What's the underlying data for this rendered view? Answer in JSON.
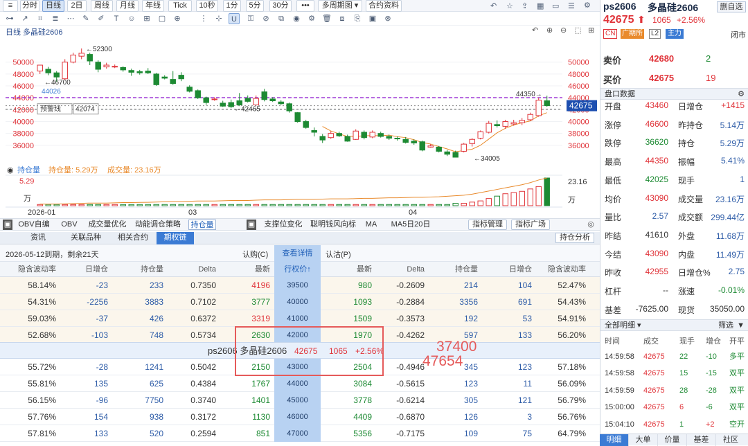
{
  "colors": {
    "up": "#e0343a",
    "down": "#1d8a33",
    "accent": "#3b7bd4",
    "ma": "#e98a2b",
    "warn": "#a03ad6"
  },
  "topbar": {
    "periods": [
      "分时",
      "日线",
      "2日",
      "周线",
      "月线",
      "年线",
      "Tick",
      "10秒",
      "1分",
      "5分",
      "30分"
    ],
    "more": "•••",
    "multi": "多周期图 ▾",
    "contract_info": "合约资料"
  },
  "toolbar": {
    "icons": [
      "trend-line-icon",
      "ray-icon",
      "horizontal-line-icon",
      "channel-icon",
      "fibonacci-icon",
      "text-icon",
      "measure-icon",
      "rect-icon",
      "magnet-icon",
      "eye-icon",
      "settings-icon",
      "lock-icon",
      "delete-icon",
      "layers-icon"
    ],
    "right_icons": [
      "undo-icon",
      "zoom-in-icon",
      "zoom-out-icon",
      "fit-icon",
      "restore-icon"
    ]
  },
  "chart": {
    "title": "日线  多晶硅2606",
    "annotations": {
      "high": "52300",
      "low_left": "46700",
      "low_mid": "42465",
      "recent_high": "44350",
      "low_right": "34005",
      "ref_price": "44026",
      "alert_label": "预警线",
      "alert_value": "42074",
      "current_price": "42675"
    },
    "y_ticks": [
      "50000",
      "48000",
      "46000",
      "44000",
      "42000",
      "40000",
      "38000",
      "36000"
    ],
    "oi_legend": "持仓量",
    "oi_label": "持仓量: 5.29万",
    "vol_label": "成交量: 23.16万",
    "oi_axis_top": "5.29",
    "oi_axis_unit": "万",
    "vol_axis_top": "23.16",
    "vol_axis_unit": "万",
    "x_labels": [
      "2026-01",
      "03",
      "04"
    ]
  },
  "chart_data": {
    "type": "candlestick",
    "y_range": [
      34000,
      53000
    ],
    "candles": [
      [
        48500,
        49500,
        49000,
        48000
      ],
      [
        48800,
        48200,
        49200,
        47800
      ],
      [
        48200,
        47500,
        48500,
        46700
      ],
      [
        47200,
        50000,
        50500,
        47000
      ],
      [
        50000,
        51200,
        51600,
        49800
      ],
      [
        51000,
        51500,
        52300,
        50500
      ],
      [
        51300,
        50200,
        51600,
        49500
      ],
      [
        50000,
        48800,
        50300,
        48300
      ],
      [
        49200,
        49500,
        49900,
        48900
      ],
      [
        49300,
        49300,
        49600,
        49000
      ],
      [
        49100,
        48700,
        49300,
        48400
      ],
      [
        48600,
        48300,
        48900,
        47700
      ],
      [
        48400,
        48200,
        48700,
        47900
      ],
      [
        48500,
        48200,
        49000,
        48000
      ],
      [
        48000,
        46200,
        48200,
        46000
      ],
      [
        47500,
        47300,
        47800,
        47100
      ],
      [
        47100,
        46400,
        48500,
        46200
      ],
      [
        47800,
        47200,
        48300,
        46800
      ],
      [
        45800,
        45100,
        46100,
        44900
      ],
      [
        45200,
        44000,
        45400,
        43800
      ],
      [
        44000,
        43200,
        44200,
        42800
      ],
      [
        43700,
        43800,
        44100,
        43500
      ],
      [
        43100,
        42600,
        43500,
        42465
      ],
      [
        43200,
        42500,
        43700,
        42300
      ],
      [
        43500,
        42800,
        44800,
        42600
      ],
      [
        43900,
        43400,
        44400,
        43200
      ],
      [
        42800,
        43900,
        44400,
        42700
      ],
      [
        45000,
        43700,
        45500,
        43400
      ],
      [
        43800,
        43500,
        44100,
        43300
      ],
      [
        43300,
        43000,
        43600,
        42800
      ],
      [
        43000,
        41800,
        43200,
        41500
      ],
      [
        41500,
        40000,
        41600,
        39800
      ],
      [
        40000,
        39000,
        40300,
        38800
      ],
      [
        38500,
        38200,
        39000,
        37500
      ],
      [
        37500,
        36900,
        37900,
        36400
      ],
      [
        37300,
        38000,
        38400,
        37100
      ],
      [
        38000,
        37600,
        38300,
        37400
      ],
      [
        37500,
        36700,
        37800,
        36600
      ],
      [
        37000,
        38400,
        38700,
        36900
      ],
      [
        38200,
        37300,
        38500,
        37000
      ],
      [
        37400,
        38200,
        38500,
        37200
      ],
      [
        38000,
        37500,
        38300,
        37300
      ],
      [
        37500,
        37200,
        37800,
        36900
      ],
      [
        37200,
        37100,
        37500,
        36800
      ],
      [
        37000,
        36500,
        37400,
        36300
      ],
      [
        36700,
        36400,
        37000,
        36100
      ],
      [
        36600,
        35200,
        36800,
        35000
      ],
      [
        35700,
        35900,
        36200,
        35600
      ],
      [
        35700,
        35000,
        35900,
        34800
      ],
      [
        34900,
        34500,
        35200,
        34200
      ],
      [
        34800,
        34000,
        35100,
        34005
      ],
      [
        35000,
        36200,
        36400,
        34800
      ],
      [
        36300,
        37000,
        37200,
        35800
      ],
      [
        37200,
        38300,
        38500,
        37000
      ],
      [
        38200,
        39700,
        40100,
        38000
      ],
      [
        39500,
        39300,
        40200,
        39000
      ],
      [
        39200,
        40000,
        40300,
        38800
      ],
      [
        39600,
        39800,
        40300,
        39300
      ],
      [
        39800,
        40200,
        40600,
        39400
      ],
      [
        40300,
        41200,
        41500,
        40100
      ],
      [
        41000,
        43600,
        44000,
        40800
      ],
      [
        43500,
        42675,
        44350,
        42500
      ]
    ],
    "oi_wan": [
      0.3,
      0.3,
      0.32,
      0.35,
      0.4,
      0.45,
      0.5,
      0.5,
      0.5,
      0.55,
      0.6,
      0.6,
      0.62,
      0.65,
      0.7,
      0.75,
      0.8,
      0.8,
      0.85,
      0.9,
      0.9,
      0.9,
      0.95,
      1.0,
      1.0,
      1.0,
      1.05,
      1.1,
      1.1,
      1.1,
      1.15,
      1.2,
      1.2,
      1.2,
      1.25,
      1.3,
      1.3,
      1.3,
      1.35,
      1.4,
      1.4,
      1.45,
      1.5,
      1.5,
      1.55,
      1.6,
      1.6,
      1.65,
      1.7,
      1.8,
      1.9,
      2.0,
      2.2,
      2.5,
      2.8,
      3.1,
      3.4,
      3.7,
      4.0,
      4.4,
      4.9,
      5.29
    ],
    "vol_wan": [
      1,
      1,
      1,
      1,
      1,
      1,
      1,
      1,
      1,
      1,
      1,
      1,
      1,
      1,
      1,
      1,
      1,
      1,
      1,
      1,
      1,
      1,
      1,
      1,
      1,
      1,
      1,
      1,
      1,
      1,
      1,
      1,
      1,
      1,
      1,
      1,
      1,
      1,
      1,
      1,
      1,
      1,
      1,
      1,
      1,
      1,
      1,
      1,
      1,
      1,
      2,
      2,
      3,
      4,
      6,
      8,
      10,
      11,
      12,
      14,
      16,
      23.16
    ]
  },
  "indicators": {
    "left": [
      "OBV自编",
      "OBV",
      "成交量优化",
      "动能调仓策略",
      "持仓量"
    ],
    "right": [
      "支撑位变化",
      "聪明钱风向标",
      "MA",
      "MA5日20日"
    ],
    "buttons": [
      "指标管理",
      "指标广场"
    ]
  },
  "tabs": [
    "资讯",
    "关联品种",
    "相关合约",
    "期权链"
  ],
  "hold_analysis": "持仓分析",
  "optbar": {
    "expiry": "2026-05-12到期，剩余21天",
    "call": "认购(C)",
    "view": "查看详情",
    "put": "认沽(P)"
  },
  "headers": {
    "call": [
      "隐含波动率",
      "日增仓",
      "持仓量",
      "Delta",
      "最新"
    ],
    "strike": "行权价↑",
    "put": [
      "最新",
      "Delta",
      "持仓量",
      "日增仓",
      "隐含波动率"
    ]
  },
  "rows_top": [
    {
      "c": [
        "58.14%",
        "-23",
        "233",
        "0.7350",
        "4196"
      ],
      "k": "39500",
      "p": [
        "980",
        "-0.2609",
        "214",
        "104",
        "52.47%"
      ],
      "cl": "red",
      "pl": "green"
    },
    {
      "c": [
        "54.31%",
        "-2256",
        "3883",
        "0.7102",
        "3777"
      ],
      "k": "40000",
      "p": [
        "1093",
        "-0.2884",
        "3356",
        "691",
        "54.43%"
      ],
      "cl": "green",
      "pl": "green"
    },
    {
      "c": [
        "59.03%",
        "-37",
        "426",
        "0.6372",
        "3319"
      ],
      "k": "41000",
      "p": [
        "1509",
        "-0.3573",
        "192",
        "53",
        "54.91%"
      ],
      "cl": "red",
      "pl": "green"
    },
    {
      "c": [
        "52.68%",
        "-103",
        "748",
        "0.5734",
        "2630"
      ],
      "k": "42000",
      "p": [
        "1970",
        "-0.4262",
        "597",
        "133",
        "56.20%"
      ],
      "cl": "green",
      "pl": "green"
    }
  ],
  "midrow": {
    "name": "ps2606 多晶硅2606",
    "price": "42675",
    "chg": "1065",
    "pct": "+2.56%"
  },
  "rows_bottom": [
    {
      "c": [
        "55.72%",
        "-28",
        "1241",
        "0.5042",
        "2150"
      ],
      "k": "43000",
      "p": [
        "2504",
        "-0.4946",
        "345",
        "123",
        "57.18%"
      ],
      "cl": "green",
      "pl": "green"
    },
    {
      "c": [
        "55.81%",
        "135",
        "625",
        "0.4384",
        "1767"
      ],
      "k": "44000",
      "p": [
        "3084",
        "-0.5615",
        "123",
        "11",
        "56.09%"
      ],
      "cl": "green",
      "pl": "green"
    },
    {
      "c": [
        "56.15%",
        "-96",
        "7750",
        "0.3740",
        "1401"
      ],
      "k": "45000",
      "p": [
        "3778",
        "-0.6214",
        "305",
        "121",
        "56.79%"
      ],
      "cl": "green",
      "pl": "green"
    },
    {
      "c": [
        "57.76%",
        "154",
        "938",
        "0.3172",
        "1130"
      ],
      "k": "46000",
      "p": [
        "4409",
        "-0.6870",
        "126",
        "3",
        "56.76%"
      ],
      "cl": "green",
      "pl": "green"
    },
    {
      "c": [
        "57.81%",
        "133",
        "520",
        "0.2594",
        "851"
      ],
      "k": "47000",
      "p": [
        "5356",
        "-0.7175",
        "109",
        "75",
        "64.79%"
      ],
      "cl": "green",
      "pl": "green"
    }
  ],
  "overlay": {
    "a": "37400",
    "b": "47654"
  },
  "right": {
    "code": "ps2606",
    "name": "多晶硅2606",
    "add": "删自选",
    "price": "42675",
    "arrow": "⬆",
    "chg": "1065",
    "pct": "+2.56%",
    "tags": [
      "CN",
      "广期所",
      "L2",
      "主力"
    ],
    "status": "闭市",
    "ask_label": "卖价",
    "ask": "42680",
    "ask_vol": "2",
    "bid_label": "买价",
    "bid": "42675",
    "bid_vol": "19",
    "panel_title": "盘口数据",
    "stats": [
      [
        "开盘",
        "43460",
        "日增仓",
        "+1415"
      ],
      [
        "涨停",
        "46600",
        "昨持仓",
        "5.14万"
      ],
      [
        "跌停",
        "36620",
        "持仓",
        "5.29万"
      ],
      [
        "最高",
        "44350",
        "振幅",
        "5.41%"
      ],
      [
        "最低",
        "42025",
        "现手",
        "1"
      ],
      [
        "均价",
        "43090",
        "成交量",
        "23.16万"
      ],
      [
        "量比",
        "2.57",
        "成交额",
        "299.44亿"
      ],
      [
        "昨结",
        "41610",
        "外盘",
        "11.68万"
      ],
      [
        "今结",
        "43090",
        "内盘",
        "11.49万"
      ],
      [
        "昨收",
        "42955",
        "日增仓%",
        "2.75"
      ],
      [
        "杠杆",
        "--",
        "涨速",
        "-0.01%"
      ],
      [
        "基差",
        "-7625.00",
        "现货",
        "35050.00"
      ]
    ],
    "trades_title": "全部明细 ▾",
    "filter": "筛选",
    "trade_head": [
      "时间",
      "成交",
      "现手",
      "增仓",
      "开平"
    ],
    "trades": [
      [
        "14:59:58",
        "42675",
        "22",
        "-10",
        "多平"
      ],
      [
        "14:59:58",
        "42675",
        "15",
        "-15",
        "双平"
      ],
      [
        "14:59:59",
        "42675",
        "28",
        "-28",
        "双平"
      ],
      [
        "15:00:00",
        "42675",
        "6",
        "-6",
        "双平"
      ],
      [
        "15:04:10",
        "42675",
        "1",
        "+2",
        "空开"
      ]
    ],
    "bottom_tabs": [
      "明细",
      "大单",
      "价量",
      "基差",
      "社区"
    ]
  }
}
